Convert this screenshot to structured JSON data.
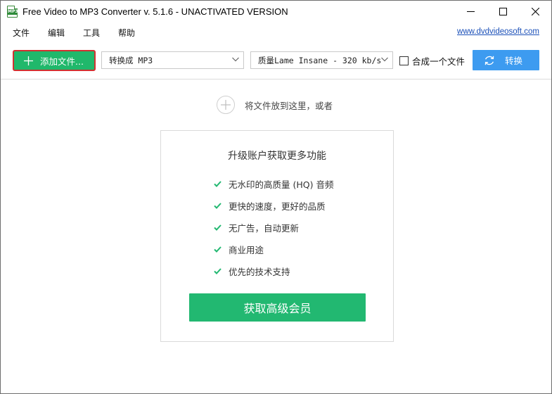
{
  "window": {
    "title": "Free Video to MP3 Converter v. 5.1.6 - UNACTIVATED VERSION",
    "icon_label": "MP3",
    "controls": [
      "minimize-icon",
      "maximize-icon",
      "close-icon"
    ]
  },
  "menu": {
    "items": [
      "文件",
      "编辑",
      "工具",
      "帮助"
    ],
    "site_link": "www.dvdvideosoft.com"
  },
  "toolbar": {
    "add_files_label": "添加文件...",
    "format_select": "转换成 MP3",
    "quality_select_prefix": "质量",
    "quality_select_value": "Lame Insane - 320 kb/s",
    "merge_label": "合成一个文件",
    "merge_checked": false,
    "convert_label": "转换",
    "accent_green": "#20b86b",
    "accent_blue": "#3d9bf0"
  },
  "dropzone": {
    "label": "将文件放到这里，或者"
  },
  "upgrade": {
    "title": "升级账户获取更多功能",
    "features": [
      "无水印的高质量 (HQ) 音频",
      "更快的速度，更好的品质",
      "无广告，自动更新",
      "商业用途",
      "优先的技术支持"
    ],
    "cta_label": "获取高级会员"
  }
}
